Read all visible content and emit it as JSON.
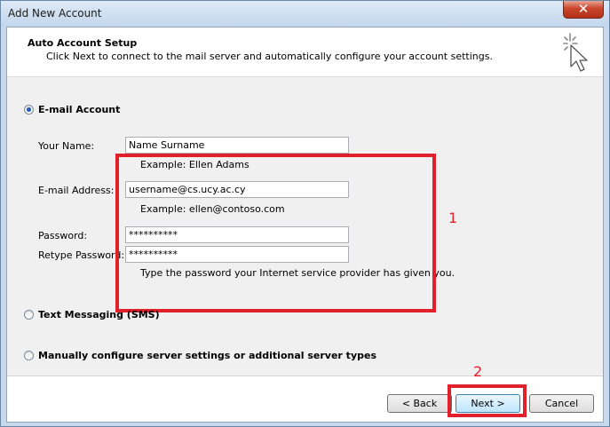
{
  "window": {
    "title": "Add New Account",
    "close_glyph": "✕"
  },
  "header": {
    "title": "Auto Account Setup",
    "subtitle": "Click Next to connect to the mail server and automatically configure your account settings.",
    "icon": "wizard-sparkle-cursor-icon"
  },
  "options": {
    "email_account": {
      "label": "E-mail Account",
      "selected": true
    },
    "text_messaging": {
      "label": "Text Messaging (SMS)",
      "selected": false
    },
    "manual_config": {
      "label": "Manually configure server settings or additional server types",
      "selected": false
    }
  },
  "form": {
    "your_name": {
      "label": "Your Name:",
      "value": "Name Surname",
      "hint": "Example: Ellen Adams"
    },
    "email_address": {
      "label": "E-mail Address:",
      "value": "username@cs.ucy.ac.cy",
      "hint": "Example: ellen@contoso.com"
    },
    "password": {
      "label": "Password:",
      "value": "**********"
    },
    "retype_password": {
      "label": "Retype Password:",
      "value": "**********",
      "hint": "Type the password your Internet service provider has given you."
    }
  },
  "annotations": {
    "marker_1": "1",
    "marker_2": "2",
    "color": "#e0202a"
  },
  "buttons": {
    "back": "< Back",
    "next": "Next >",
    "cancel": "Cancel"
  }
}
